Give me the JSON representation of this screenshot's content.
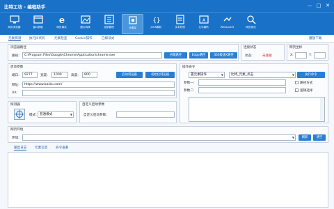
{
  "window": {
    "title": "比特工坊 - 编程助手",
    "minimize": "—",
    "maximize": "□",
    "close": "✕"
  },
  "toolbar": [
    {
      "label": "网页浏览器",
      "icon": "monitor-icon"
    },
    {
      "label": "窗口抓取",
      "icon": "window-icon"
    },
    {
      "label": "网页调试",
      "icon": "ie-browser-icon"
    },
    {
      "label": "图片转换",
      "icon": "image-icon"
    },
    {
      "label": "控制管理",
      "icon": "control-panel-icon"
    },
    {
      "label": "元素定",
      "icon": "element-locator-icon"
    },
    {
      "label": "JSON解析",
      "icon": "json-icon"
    },
    {
      "label": "文本处理",
      "icon": "text-icon"
    },
    {
      "label": "文字编码",
      "icon": "encoding-icon"
    },
    {
      "label": "Websocket",
      "icon": "websocket-icon"
    },
    {
      "label": "网页测试",
      "icon": "search-icon"
    }
  ],
  "tabs": [
    "元素探测",
    "执行JS代码",
    "元素检查",
    "Cookie操作",
    "已解读式"
  ],
  "tab_right": "播放下载",
  "browser_path": {
    "title": "浏览器路径",
    "label": "路径:",
    "value": "C:\\Program Files\\Google\\Chrome\\Application\\chrome.exe",
    "btn_chrome": "谷歌路径",
    "btn_edge": "Edge路径",
    "btn_360": "360极速X路径"
  },
  "connection": {
    "title": "连接状态",
    "label": "状态:",
    "value": "未连接",
    "status_color": "#dd2222"
  },
  "page_coords": {
    "title": "网页坐标",
    "x_label": "X:",
    "y_label": "Y:"
  },
  "start_params": {
    "title": "启动参数",
    "port_label": "端口:",
    "port": "9277",
    "width_label": "宽度:",
    "width": "1000",
    "height_label": "高度:",
    "height": "800",
    "btn_start": "启动浏览器",
    "btn_init": "初始化浏览器",
    "url_label": "网址:",
    "url": "https://www.baidu.com/",
    "ua_label": "UA:"
  },
  "operation": {
    "title": "操作命令",
    "op_select": "置元素操作",
    "action_select": "比特_元素_点击",
    "btn_exec": "执行命令",
    "param1_label": "参数一:",
    "param2_label": "参数二:",
    "chk1": "路径方式",
    "chk2": "逻辑选择"
  },
  "detector": {
    "title": "探测器",
    "mode_label": "模式:",
    "mode": "普通模式"
  },
  "custom_params": {
    "title": "自定义启动参数",
    "label": "自定义启动参数:"
  },
  "env": {
    "title": "网页环境",
    "label": "环境:",
    "btn_refresh": "刷新",
    "btn_clear": "清空"
  },
  "log_tabs": [
    "输出日志",
    "元素信息",
    "命令查看"
  ]
}
